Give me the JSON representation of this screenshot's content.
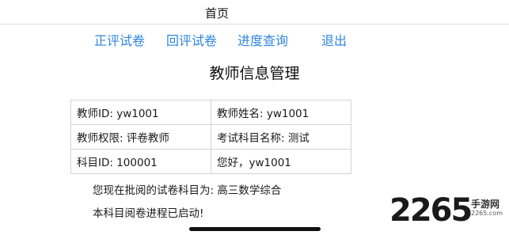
{
  "header": {
    "title": "首页"
  },
  "nav": {
    "items": [
      {
        "label": "正评试卷"
      },
      {
        "label": "回评试卷"
      },
      {
        "label": "进度查询"
      },
      {
        "label": "退出"
      }
    ]
  },
  "main": {
    "title": "教师信息管理",
    "info": [
      [
        "教师ID: yw1001",
        "教师姓名: yw1001"
      ],
      [
        "教师权限: 评卷教师",
        "考试科目名称: 测试"
      ],
      [
        "科目ID: 100001",
        "您好，yw1001"
      ]
    ],
    "status_subject": "您现在批阅的试卷科目为: 高三数学综合",
    "status_progress": "本科目阅卷进程已启动!"
  },
  "watermark": {
    "number": "2265",
    "cn": "手游网",
    "en": "2265.com"
  },
  "colors": {
    "link": "#2f86e0",
    "watermark_accent": "#e8a31c"
  }
}
